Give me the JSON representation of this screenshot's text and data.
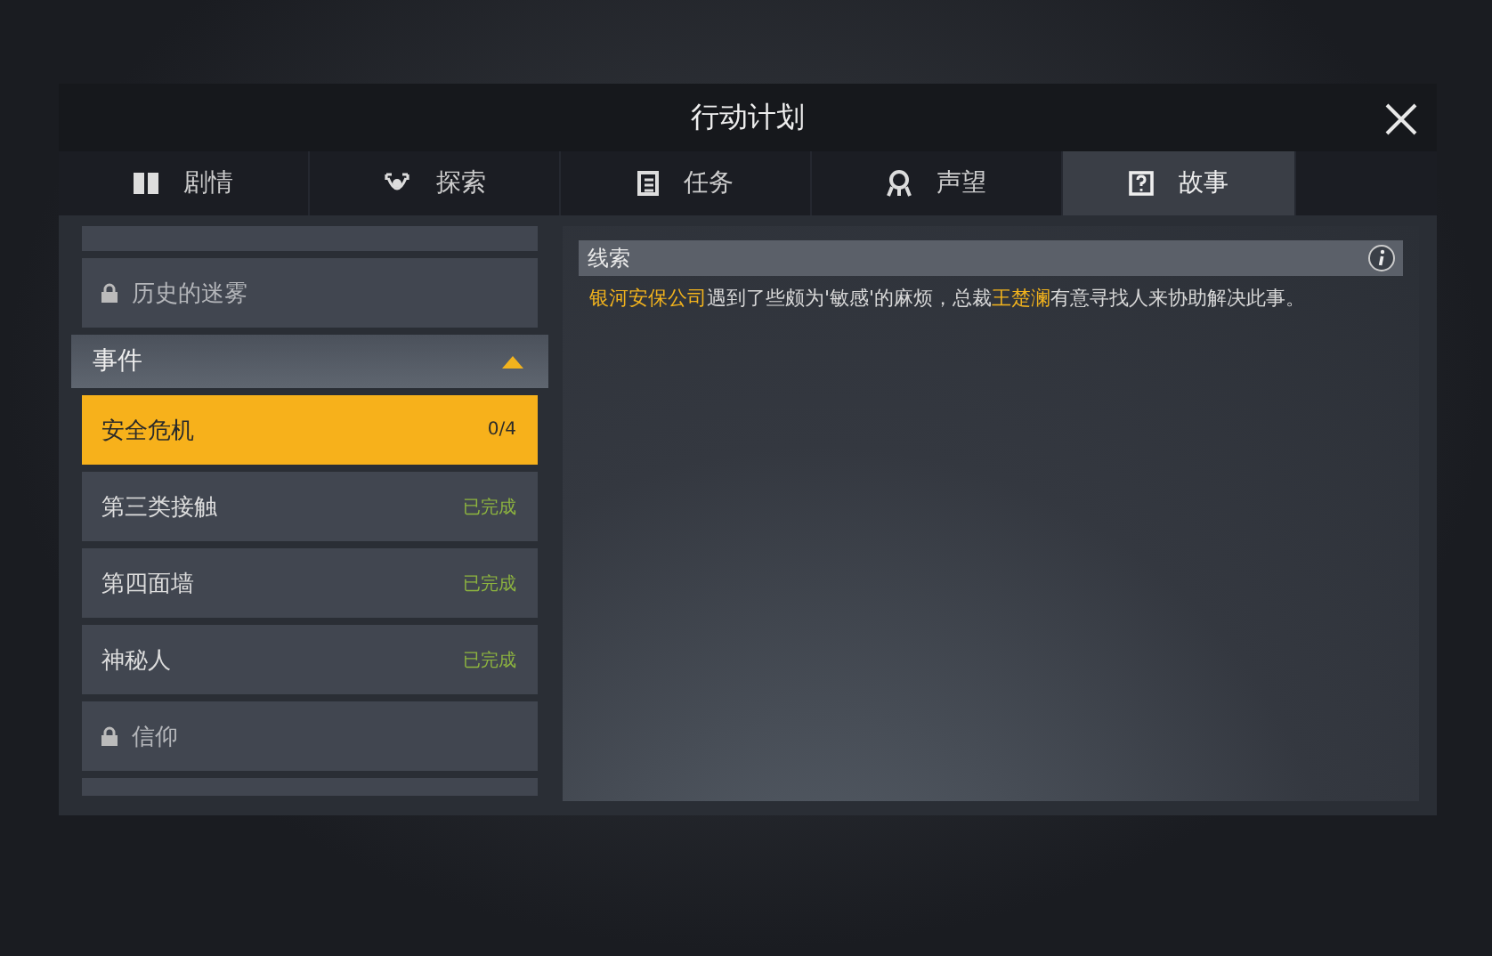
{
  "window": {
    "title": "行动计划"
  },
  "tabs": [
    {
      "label": "剧情",
      "selected": false
    },
    {
      "label": "探索",
      "selected": false
    },
    {
      "label": "任务",
      "selected": false
    },
    {
      "label": "声望",
      "selected": false
    },
    {
      "label": "故事",
      "selected": true
    }
  ],
  "story_list": [
    {
      "kind": "item",
      "label": "历史的迷雾",
      "locked": true,
      "selected": false
    },
    {
      "kind": "category",
      "label": "事件",
      "expanded": true
    },
    {
      "kind": "item",
      "label": "安全危机",
      "status": "0/4",
      "locked": false,
      "selected": true
    },
    {
      "kind": "item",
      "label": "第三类接触",
      "status": "已完成",
      "locked": false,
      "selected": false
    },
    {
      "kind": "item",
      "label": "第四面墙",
      "status": "已完成",
      "locked": false,
      "selected": false
    },
    {
      "kind": "item",
      "label": "神秘人",
      "status": "已完成",
      "locked": false,
      "selected": false
    },
    {
      "kind": "item",
      "label": "信仰",
      "locked": true,
      "selected": false
    }
  ],
  "clue": {
    "heading": "线索",
    "text": [
      {
        "text": "银河安保公司",
        "highlight": true
      },
      {
        "text": "遇到了些颇为'敏感'的麻烦，总裁",
        "highlight": false
      },
      {
        "text": "王楚澜",
        "highlight": true
      },
      {
        "text": "有意寻找人来协助解决此事。",
        "highlight": false
      }
    ]
  }
}
